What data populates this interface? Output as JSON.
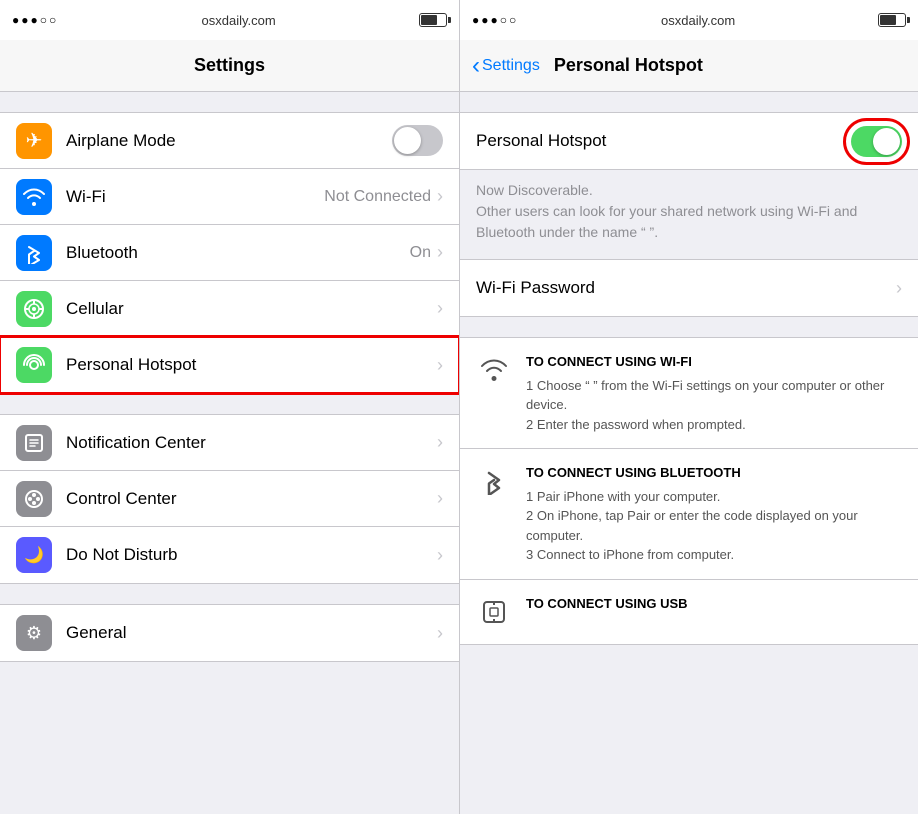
{
  "left_panel": {
    "status_bar": {
      "dots": "●●●○○",
      "url": "osxdaily.com",
      "battery_label": "battery"
    },
    "nav_title": "Settings",
    "rows": [
      {
        "id": "airplane",
        "label": "Airplane Mode",
        "icon_bg": "#ff9500",
        "icon": "✈",
        "type": "toggle",
        "value": ""
      },
      {
        "id": "wifi",
        "label": "Wi-Fi",
        "icon_bg": "#007aff",
        "icon": "📶",
        "type": "chevron",
        "value": "Not Connected"
      },
      {
        "id": "bluetooth",
        "label": "Bluetooth",
        "icon_bg": "#007aff",
        "icon": "✦",
        "type": "chevron",
        "value": "On"
      },
      {
        "id": "cellular",
        "label": "Cellular",
        "icon_bg": "#4cd964",
        "icon": "📡",
        "type": "chevron",
        "value": ""
      },
      {
        "id": "hotspot",
        "label": "Personal Hotspot",
        "icon_bg": "#4cd964",
        "icon": "⊕",
        "type": "chevron",
        "value": "",
        "highlighted": true
      }
    ],
    "rows2": [
      {
        "id": "notification",
        "label": "Notification Center",
        "icon_bg": "#8e8e93",
        "icon": "🔲",
        "type": "chevron",
        "value": ""
      },
      {
        "id": "control",
        "label": "Control Center",
        "icon_bg": "#8e8e93",
        "icon": "⊙",
        "type": "chevron",
        "value": ""
      },
      {
        "id": "dnd",
        "label": "Do Not Disturb",
        "icon_bg": "#5a5aff",
        "icon": "🌙",
        "type": "chevron",
        "value": ""
      }
    ],
    "rows3": [
      {
        "id": "general",
        "label": "General",
        "icon_bg": "#8e8e93",
        "icon": "⚙",
        "type": "chevron",
        "value": ""
      }
    ]
  },
  "right_panel": {
    "status_bar": {
      "dots": "●●●○○",
      "url": "osxdaily.com",
      "battery_label": "battery"
    },
    "back_label": "Settings",
    "nav_title": "Personal Hotspot",
    "toggle_label": "Personal Hotspot",
    "toggle_state": "on",
    "discoverable_line1": "Now Discoverable.",
    "discoverable_line2": "Other users can look for your shared network using Wi-Fi and Bluetooth under the name “                  ”.",
    "wifi_password_label": "Wi-Fi Password",
    "instructions": [
      {
        "icon": "wifi",
        "title": "TO CONNECT USING WI-FI",
        "steps": "1 Choose “                  ” from the Wi-Fi settings on your computer or other device.\n2 Enter the password when prompted."
      },
      {
        "icon": "bluetooth",
        "title": "TO CONNECT USING BLUETOOTH",
        "steps": "1 Pair iPhone with your computer.\n2 On iPhone, tap Pair or enter the code displayed on your computer.\n3 Connect to iPhone from computer."
      },
      {
        "icon": "usb",
        "title": "TO CONNECT USING USB",
        "steps": ""
      }
    ]
  }
}
